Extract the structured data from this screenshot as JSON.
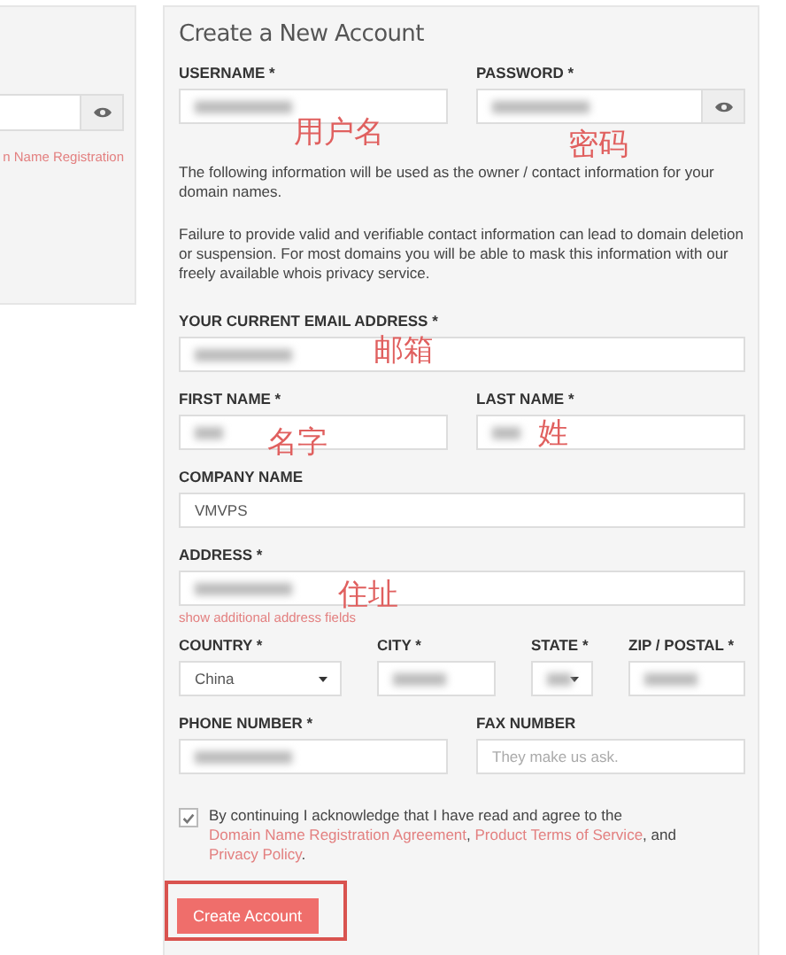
{
  "side_panel": {
    "link": "n Name Registration"
  },
  "form": {
    "title": "Create a New Account",
    "rows": [
      [
        {
          "kind": "text",
          "label": "USERNAME *",
          "redacted": true,
          "annotation": "用户名"
        },
        {
          "kind": "password",
          "label": "PASSWORD *",
          "redacted": true,
          "annotation": "密码"
        }
      ],
      {
        "kind": "notes",
        "paragraphs": [
          "The following information will be used as the owner / contact information for your domain names.",
          "Failure to provide valid and verifiable contact information can lead to domain deletion or suspension. For most domains you will be able to mask this information with our freely available whois privacy service."
        ]
      },
      [
        {
          "kind": "text",
          "label": "YOUR CURRENT EMAIL ADDRESS *",
          "redacted": true,
          "annotation": "邮箱"
        }
      ],
      [
        {
          "kind": "text",
          "label": "FIRST NAME *",
          "redacted": true,
          "annotation": "名字"
        },
        {
          "kind": "text",
          "label": "LAST NAME *",
          "redacted": true,
          "annotation": "姓"
        }
      ],
      [
        {
          "kind": "text",
          "label": "COMPANY NAME",
          "value": "VMVPS",
          "redacted": false
        }
      ],
      [
        {
          "kind": "text",
          "label": "ADDRESS *",
          "redacted": true,
          "annotation": "住址",
          "helper_link": "show additional address fields"
        }
      ],
      [
        {
          "kind": "select",
          "label": "COUNTRY *",
          "value": "China",
          "redacted": false
        },
        {
          "kind": "text",
          "label": "CITY *",
          "redacted": true
        },
        {
          "kind": "select",
          "label": "STATE *",
          "redacted": true
        },
        {
          "kind": "text",
          "label": "ZIP / POSTAL *",
          "redacted": true
        }
      ],
      [
        {
          "kind": "text",
          "label": "PHONE NUMBER *",
          "redacted": true
        },
        {
          "kind": "text",
          "label": "FAX NUMBER",
          "placeholder": "They make us ask.",
          "redacted": false
        }
      ]
    ],
    "consent": {
      "checked": true,
      "parts": [
        {
          "text": "By continuing I acknowledge that I have read and agree to the ",
          "link": false
        },
        {
          "text": "Domain Name Registration Agreement",
          "link": true
        },
        {
          "text": ", ",
          "link": false
        },
        {
          "text": "Product Terms of Service",
          "link": true
        },
        {
          "text": ", and ",
          "link": false
        },
        {
          "text": "Privacy Policy",
          "link": true
        },
        {
          "text": ".",
          "link": false
        }
      ]
    },
    "submit": {
      "label": "Create Account",
      "highlighted": true
    }
  }
}
